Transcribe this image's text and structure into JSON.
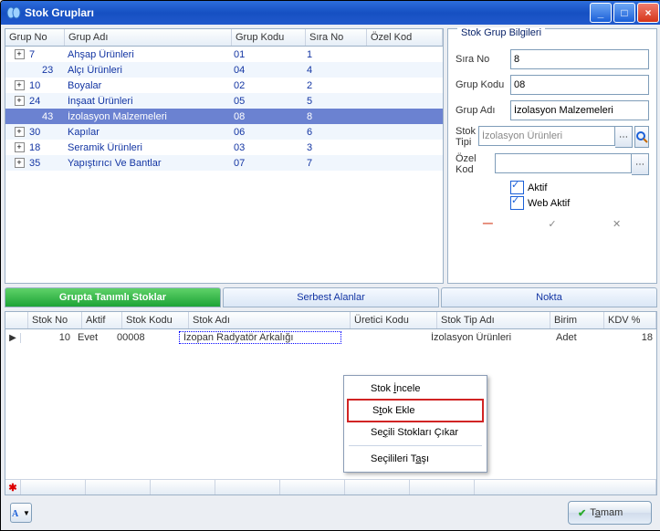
{
  "window": {
    "title": "Stok Grupları"
  },
  "tree": {
    "headers": {
      "no": "Grup No",
      "adi": "Grup Adı",
      "kodu": "Grup Kodu",
      "sira": "Sıra No",
      "ozel": "Özel Kod"
    },
    "rows": [
      {
        "no": "7",
        "adi": "Ahşap Ürünleri",
        "kodu": "01",
        "sira": "1",
        "exp": true,
        "sel": false,
        "indent": 0
      },
      {
        "no": "23",
        "adi": "Alçı Ürünleri",
        "kodu": "04",
        "sira": "4",
        "exp": false,
        "sel": false,
        "indent": 1
      },
      {
        "no": "10",
        "adi": "Boyalar",
        "kodu": "02",
        "sira": "2",
        "exp": true,
        "sel": false,
        "indent": 0
      },
      {
        "no": "24",
        "adi": "İnşaat Ürünleri",
        "kodu": "05",
        "sira": "5",
        "exp": true,
        "sel": false,
        "indent": 0
      },
      {
        "no": "43",
        "adi": "İzolasyon Malzemeleri",
        "kodu": "08",
        "sira": "8",
        "exp": false,
        "sel": true,
        "indent": 1
      },
      {
        "no": "30",
        "adi": "Kapılar",
        "kodu": "06",
        "sira": "6",
        "exp": true,
        "sel": false,
        "indent": 0
      },
      {
        "no": "18",
        "adi": "Seramik Ürünleri",
        "kodu": "03",
        "sira": "3",
        "exp": true,
        "sel": false,
        "indent": 0
      },
      {
        "no": "35",
        "adi": "Yapıştırıcı Ve Bantlar",
        "kodu": "07",
        "sira": "7",
        "exp": true,
        "sel": false,
        "indent": 0
      }
    ]
  },
  "info": {
    "legend": "Stok Grup Bilgileri",
    "labels": {
      "sira": "Sıra No",
      "kodu": "Grup Kodu",
      "adi": "Grup Adı",
      "tipi": "Stok Tipi",
      "ozel": "Özel Kod"
    },
    "values": {
      "sira": "8",
      "kodu": "08",
      "adi": "İzolasyon Malzemeleri",
      "tipi": "İzolasyon Ürünleri",
      "ozel": ""
    },
    "checks": {
      "aktif": "Aktif",
      "web": "Web Aktif"
    }
  },
  "tabs": {
    "t1": "Grupta Tanımlı Stoklar",
    "t2": "Serbest Alanlar",
    "t3": "Nokta"
  },
  "grid": {
    "headers": {
      "stokno": "Stok No",
      "aktif": "Aktif",
      "stokkodu": "Stok Kodu",
      "stokadi": "Stok Adı",
      "uretici": "Üretici Kodu",
      "tipadi": "Stok Tip Adı",
      "birim": "Birim",
      "kdv": "KDV %"
    },
    "row": {
      "stokno": "10",
      "aktif": "Evet",
      "stokkodu": "00008",
      "stokadi": "İzopan Radyatör Arkalığı",
      "uretici": "",
      "tipadi": "İzolasyon Ürünleri",
      "birim": "Adet",
      "kdv": "18"
    }
  },
  "context": {
    "m1_pre": "Stok ",
    "m1_u": "İ",
    "m1_post": "ncele",
    "m2_pre": "S",
    "m2_u": "t",
    "m2_post": "ok Ekle",
    "m3_pre": "Se",
    "m3_u": "ç",
    "m3_post": "ili Stokları Çıkar",
    "m4_pre": "Seçilileri T",
    "m4_u": "a",
    "m4_post": "şı"
  },
  "footer": {
    "tamam_pre": "T",
    "tamam_u": "a",
    "tamam_post": "mam"
  },
  "colors": {
    "accent": "#1a5fd8",
    "selrow": "#6b82d1"
  }
}
